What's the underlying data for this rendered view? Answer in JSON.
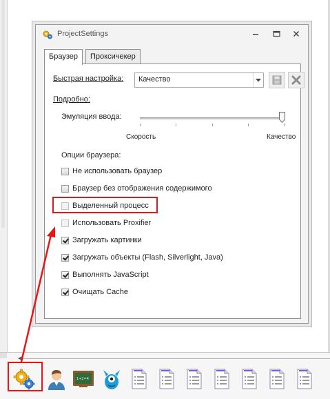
{
  "window": {
    "title": "ProjectSettings",
    "icon": "gears-icon",
    "controls": {
      "minimize": "minimize-icon",
      "maximize": "maximize-icon",
      "close": "close-icon"
    }
  },
  "tabs": [
    {
      "label": "Браузер",
      "active": true
    },
    {
      "label": "Проксичекер",
      "active": false
    }
  ],
  "quick_setup": {
    "label": "Быстрая настройка:",
    "value": "Качество",
    "save_icon": "save-disk-icon",
    "delete_icon": "delete-x-icon"
  },
  "details": {
    "label": "Подробно:"
  },
  "input_emulation": {
    "label": "Эмуляция ввода:",
    "min_label": "Скорость",
    "max_label": "Качество",
    "level": 1.0
  },
  "browser_options": {
    "title": "Опции браузера:",
    "items": [
      {
        "label": "Не использовать браузер",
        "checked": false
      },
      {
        "label": "Браузер без отображения содержимого",
        "checked": false
      },
      {
        "label": "Выделенный процесс",
        "checked": false,
        "highlighted": true
      },
      {
        "label": "Использовать Proxifier",
        "checked": false
      },
      {
        "label": "Загружать картинки",
        "checked": true
      },
      {
        "label": "Загружать объекты (Flash, Silverlight, Java)",
        "checked": true
      },
      {
        "label": "Выполнять JavaScript",
        "checked": true
      },
      {
        "label": "Очищать Cache",
        "checked": true
      }
    ]
  },
  "taskbar": {
    "items": [
      "gears-icon",
      "user-icon",
      "chalkboard-icon",
      "blue-monster-icon",
      "document-icon",
      "document-icon",
      "document-icon",
      "document-icon",
      "document-icon",
      "document-icon",
      "document-icon"
    ]
  },
  "annotation": {
    "color": "#e01818"
  },
  "colors": {
    "accent": "#e01818",
    "window_bg": "#f3f3f3",
    "panel_bg": "#ffffff"
  }
}
